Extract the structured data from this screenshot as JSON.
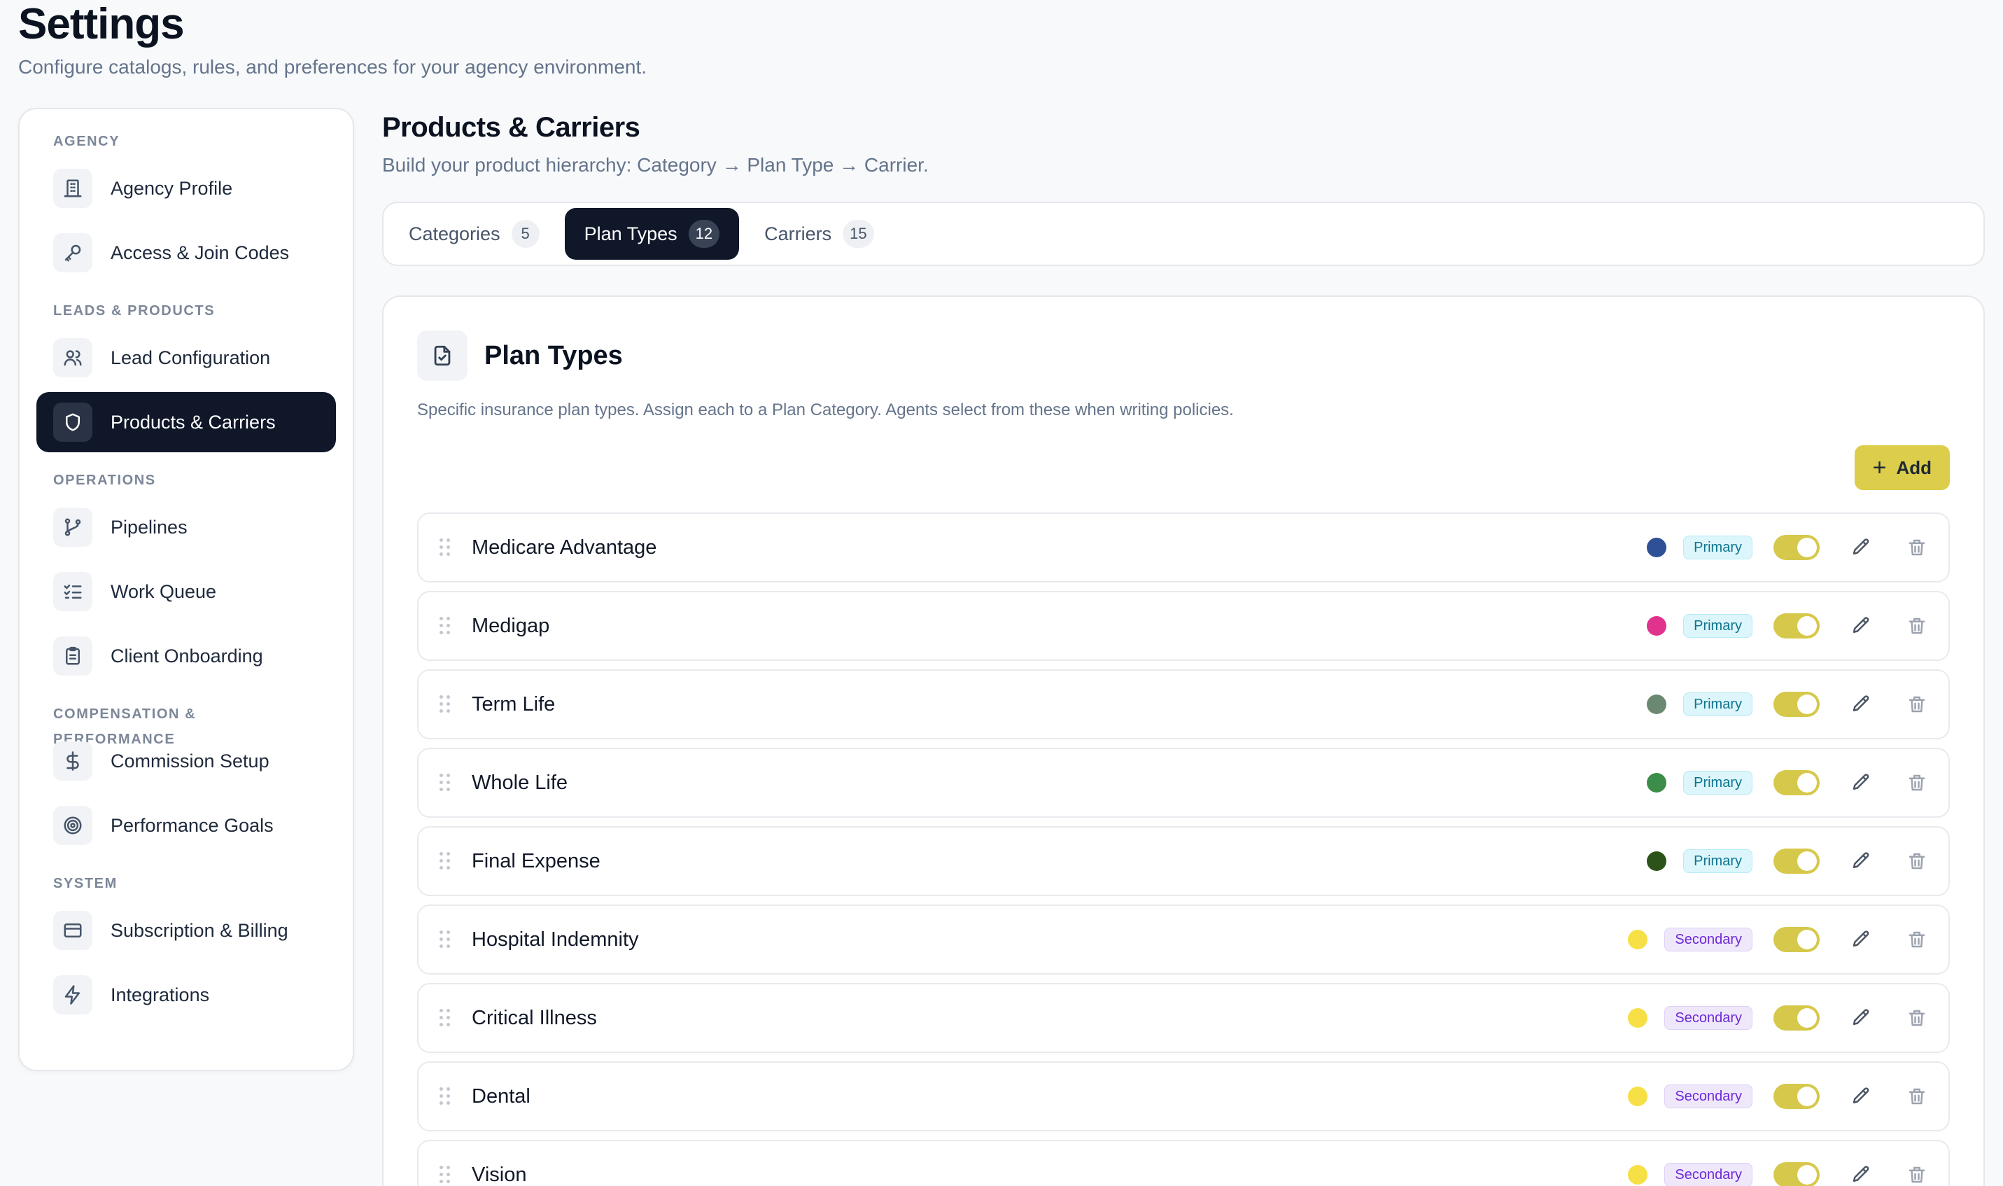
{
  "header": {
    "title": "Settings",
    "subtitle": "Configure catalogs, rules, and preferences for your agency environment."
  },
  "sidebar": {
    "sections": [
      {
        "label": "AGENCY",
        "items": [
          {
            "label": "Agency Profile",
            "icon": "building-icon"
          },
          {
            "label": "Access & Join Codes",
            "icon": "key-icon"
          }
        ]
      },
      {
        "label": "LEADS & PRODUCTS",
        "items": [
          {
            "label": "Lead Configuration",
            "icon": "users-icon"
          },
          {
            "label": "Products & Carriers",
            "icon": "shield-icon",
            "active": true
          }
        ]
      },
      {
        "label": "OPERATIONS",
        "items": [
          {
            "label": "Pipelines",
            "icon": "branch-icon"
          },
          {
            "label": "Work Queue",
            "icon": "list-checks-icon"
          },
          {
            "label": "Client Onboarding",
            "icon": "clipboard-icon"
          }
        ]
      },
      {
        "label": "COMPENSATION & PERFORMANCE",
        "items": [
          {
            "label": "Commission Setup",
            "icon": "dollar-icon"
          },
          {
            "label": "Performance Goals",
            "icon": "target-icon"
          }
        ]
      },
      {
        "label": "SYSTEM",
        "items": [
          {
            "label": "Subscription & Billing",
            "icon": "credit-card-icon"
          },
          {
            "label": "Integrations",
            "icon": "bolt-icon"
          }
        ]
      }
    ]
  },
  "main": {
    "title": "Products & Carriers",
    "subtitle": "Build your product hierarchy: Category → Plan Type → Carrier.",
    "tabs": [
      {
        "label": "Categories",
        "count": "5"
      },
      {
        "label": "Plan Types",
        "count": "12",
        "active": true
      },
      {
        "label": "Carriers",
        "count": "15"
      }
    ],
    "panel": {
      "icon": "file-check-icon",
      "title": "Plan Types",
      "description": "Specific insurance plan types. Assign each to a Plan Category. Agents select from these when writing policies.",
      "add_label": "Add",
      "rows": [
        {
          "name": "Medicare Advantage",
          "color": "#2f4f96",
          "badge": "Primary",
          "enabled": true
        },
        {
          "name": "Medigap",
          "color": "#e0338e",
          "badge": "Primary",
          "enabled": true
        },
        {
          "name": "Term Life",
          "color": "#6b8872",
          "badge": "Primary",
          "enabled": true
        },
        {
          "name": "Whole Life",
          "color": "#3d8d4a",
          "badge": "Primary",
          "enabled": true
        },
        {
          "name": "Final Expense",
          "color": "#2d5418",
          "badge": "Primary",
          "enabled": true
        },
        {
          "name": "Hospital Indemnity",
          "color": "#f6e046",
          "badge": "Secondary",
          "enabled": true
        },
        {
          "name": "Critical Illness",
          "color": "#f6e046",
          "badge": "Secondary",
          "enabled": true
        },
        {
          "name": "Dental",
          "color": "#f6e046",
          "badge": "Secondary",
          "enabled": true
        },
        {
          "name": "Vision",
          "color": "#f6e046",
          "badge": "Secondary",
          "enabled": true
        }
      ]
    }
  }
}
